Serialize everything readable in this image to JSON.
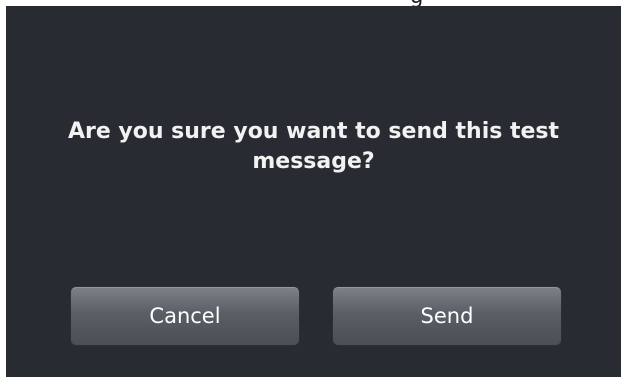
{
  "header": {
    "partial_text": "g"
  },
  "dialog": {
    "message": "Are you sure you want to send this test message?",
    "buttons": {
      "cancel_label": "Cancel",
      "send_label": "Send"
    }
  },
  "colors": {
    "dialog_background": "#282b31",
    "button_background": "#5a5f66",
    "text": "#f2f2f2"
  }
}
